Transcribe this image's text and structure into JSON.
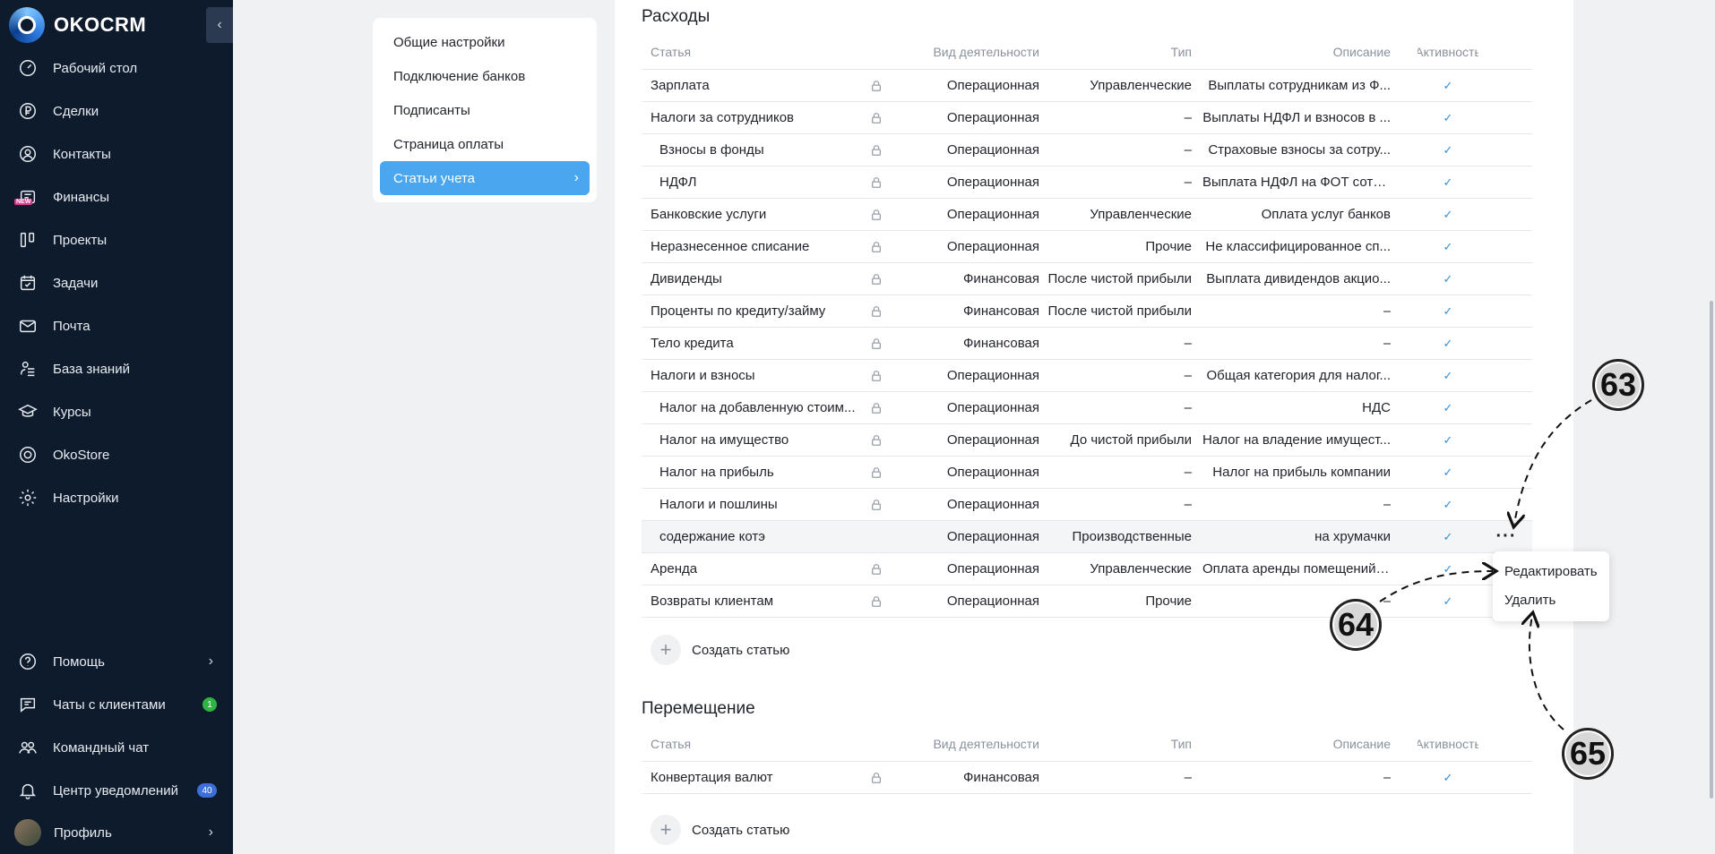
{
  "app": {
    "name": "OKOCRM"
  },
  "sidebar": {
    "items": [
      {
        "label": "Рабочий стол",
        "icon": "gauge-icon"
      },
      {
        "label": "Сделки",
        "icon": "ruble-icon"
      },
      {
        "label": "Контакты",
        "icon": "user-circle-icon"
      },
      {
        "label": "Финансы",
        "icon": "finance-icon",
        "badge": "NEW"
      },
      {
        "label": "Проекты",
        "icon": "kanban-icon"
      },
      {
        "label": "Задачи",
        "icon": "calendar-check-icon"
      },
      {
        "label": "Почта",
        "icon": "mail-icon"
      },
      {
        "label": "База знаний",
        "icon": "knowledge-icon"
      },
      {
        "label": "Курсы",
        "icon": "graduation-cap-icon"
      },
      {
        "label": "OkoStore",
        "icon": "store-icon"
      },
      {
        "label": "Настройки",
        "icon": "gear-icon"
      }
    ],
    "bottom": [
      {
        "label": "Помощь",
        "icon": "help-icon"
      },
      {
        "label": "Чаты с клиентами",
        "icon": "chat-icon",
        "count": "1"
      },
      {
        "label": "Командный чат",
        "icon": "team-icon"
      },
      {
        "label": "Центр уведомлений",
        "icon": "bell-icon",
        "count": "40"
      },
      {
        "label": "Профиль",
        "icon": "avatar"
      }
    ]
  },
  "settings_nav": {
    "items": [
      "Общие настройки",
      "Подключение банков",
      "Подписанты",
      "Страница оплаты",
      "Статьи учета"
    ],
    "active": "Статьи учета"
  },
  "table_headers": {
    "name": "Статья",
    "activity": "Вид деятельности",
    "type": "Тип",
    "description": "Описание",
    "active": "Активность"
  },
  "expenses": {
    "title": "Расходы",
    "rows": [
      {
        "name": "Зарплата",
        "activity": "Операционная",
        "type": "Управленческие",
        "description": "Выплаты сотрудникам из Ф...",
        "locked": true,
        "sub": false
      },
      {
        "name": "Налоги за сотрудников",
        "activity": "Операционная",
        "type": "–",
        "description": "Выплаты НДФЛ и взносов в ...",
        "locked": true,
        "sub": false
      },
      {
        "name": "Взносы в фонды",
        "activity": "Операционная",
        "type": "–",
        "description": "Страховые взносы за сотру...",
        "locked": true,
        "sub": true
      },
      {
        "name": "НДФЛ",
        "activity": "Операционная",
        "type": "–",
        "description": "Выплата НДФЛ на ФОТ сотр...",
        "locked": true,
        "sub": true
      },
      {
        "name": "Банковские услуги",
        "activity": "Операционная",
        "type": "Управленческие",
        "description": "Оплата услуг банков",
        "locked": true,
        "sub": false
      },
      {
        "name": "Неразнесенное списание",
        "activity": "Операционная",
        "type": "Прочие",
        "description": "Не классифицированное сп...",
        "locked": true,
        "sub": false
      },
      {
        "name": "Дивиденды",
        "activity": "Финансовая",
        "type": "После чистой прибыли",
        "description": "Выплата дивидендов акцио...",
        "locked": true,
        "sub": false
      },
      {
        "name": "Проценты по кредиту/займу",
        "activity": "Финансовая",
        "type": "После чистой прибыли",
        "description": "–",
        "locked": true,
        "sub": false
      },
      {
        "name": "Тело кредита",
        "activity": "Финансовая",
        "type": "–",
        "description": "–",
        "locked": true,
        "sub": false
      },
      {
        "name": "Налоги и взносы",
        "activity": "Операционная",
        "type": "–",
        "description": "Общая категория для налог...",
        "locked": true,
        "sub": false
      },
      {
        "name": "Налог на добавленную стоим...",
        "activity": "Операционная",
        "type": "–",
        "description": "НДС",
        "locked": true,
        "sub": true
      },
      {
        "name": "Налог на имущество",
        "activity": "Операционная",
        "type": "До чистой прибыли",
        "description": "Налог на владение имущест...",
        "locked": true,
        "sub": true
      },
      {
        "name": "Налог на прибыль",
        "activity": "Операционная",
        "type": "–",
        "description": "Налог на прибыль компании",
        "locked": true,
        "sub": true
      },
      {
        "name": "Налоги и пошлины",
        "activity": "Операционная",
        "type": "–",
        "description": "–",
        "locked": true,
        "sub": true
      },
      {
        "name": "содержание котэ",
        "activity": "Операционная",
        "type": "Производственные",
        "description": "на хрумачки",
        "locked": false,
        "sub": true,
        "hover": true
      },
      {
        "name": "Аренда",
        "activity": "Операционная",
        "type": "Управленческие",
        "description": "Оплата аренды помещений ...",
        "locked": true,
        "sub": false
      },
      {
        "name": "Возвраты клиентам",
        "activity": "Операционная",
        "type": "Прочие",
        "description": "–",
        "locked": true,
        "sub": false
      }
    ],
    "create_label": "Создать статью"
  },
  "transfer": {
    "title": "Перемещение",
    "rows": [
      {
        "name": "Конвертация валют",
        "activity": "Финансовая",
        "type": "–",
        "description": "–",
        "locked": true,
        "sub": false
      }
    ],
    "create_label": "Создать статью"
  },
  "row_menu": {
    "more_label": "···",
    "items": [
      "Редактировать",
      "Удалить"
    ]
  },
  "callouts": [
    "63",
    "64",
    "65"
  ],
  "colors": {
    "sidebar_bg": "#0e1b2c",
    "accent": "#4aa6ee",
    "check": "#2e90e0"
  }
}
